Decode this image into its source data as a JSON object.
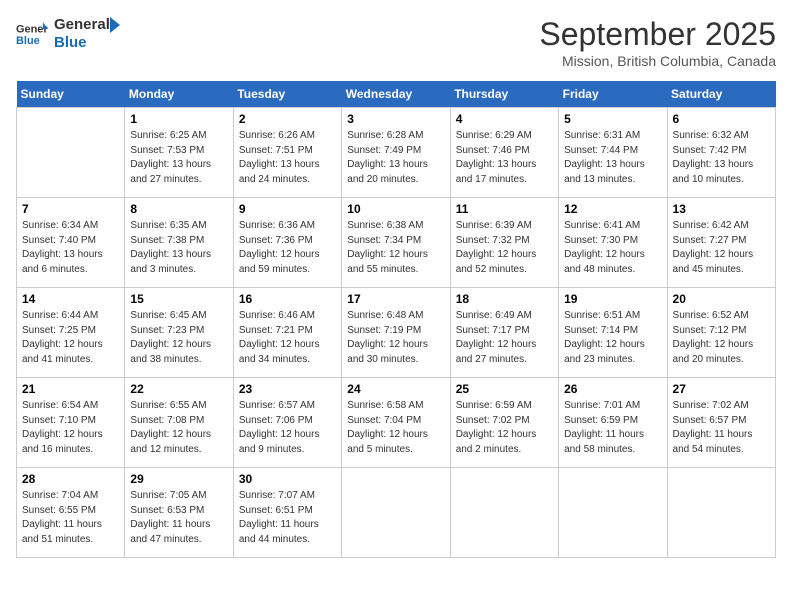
{
  "header": {
    "logo_line1": "General",
    "logo_line2": "Blue",
    "month": "September 2025",
    "location": "Mission, British Columbia, Canada"
  },
  "calendar": {
    "weekdays": [
      "Sunday",
      "Monday",
      "Tuesday",
      "Wednesday",
      "Thursday",
      "Friday",
      "Saturday"
    ],
    "weeks": [
      [
        {
          "day": "",
          "info": ""
        },
        {
          "day": "1",
          "info": "Sunrise: 6:25 AM\nSunset: 7:53 PM\nDaylight: 13 hours\nand 27 minutes."
        },
        {
          "day": "2",
          "info": "Sunrise: 6:26 AM\nSunset: 7:51 PM\nDaylight: 13 hours\nand 24 minutes."
        },
        {
          "day": "3",
          "info": "Sunrise: 6:28 AM\nSunset: 7:49 PM\nDaylight: 13 hours\nand 20 minutes."
        },
        {
          "day": "4",
          "info": "Sunrise: 6:29 AM\nSunset: 7:46 PM\nDaylight: 13 hours\nand 17 minutes."
        },
        {
          "day": "5",
          "info": "Sunrise: 6:31 AM\nSunset: 7:44 PM\nDaylight: 13 hours\nand 13 minutes."
        },
        {
          "day": "6",
          "info": "Sunrise: 6:32 AM\nSunset: 7:42 PM\nDaylight: 13 hours\nand 10 minutes."
        }
      ],
      [
        {
          "day": "7",
          "info": "Sunrise: 6:34 AM\nSunset: 7:40 PM\nDaylight: 13 hours\nand 6 minutes."
        },
        {
          "day": "8",
          "info": "Sunrise: 6:35 AM\nSunset: 7:38 PM\nDaylight: 13 hours\nand 3 minutes."
        },
        {
          "day": "9",
          "info": "Sunrise: 6:36 AM\nSunset: 7:36 PM\nDaylight: 12 hours\nand 59 minutes."
        },
        {
          "day": "10",
          "info": "Sunrise: 6:38 AM\nSunset: 7:34 PM\nDaylight: 12 hours\nand 55 minutes."
        },
        {
          "day": "11",
          "info": "Sunrise: 6:39 AM\nSunset: 7:32 PM\nDaylight: 12 hours\nand 52 minutes."
        },
        {
          "day": "12",
          "info": "Sunrise: 6:41 AM\nSunset: 7:30 PM\nDaylight: 12 hours\nand 48 minutes."
        },
        {
          "day": "13",
          "info": "Sunrise: 6:42 AM\nSunset: 7:27 PM\nDaylight: 12 hours\nand 45 minutes."
        }
      ],
      [
        {
          "day": "14",
          "info": "Sunrise: 6:44 AM\nSunset: 7:25 PM\nDaylight: 12 hours\nand 41 minutes."
        },
        {
          "day": "15",
          "info": "Sunrise: 6:45 AM\nSunset: 7:23 PM\nDaylight: 12 hours\nand 38 minutes."
        },
        {
          "day": "16",
          "info": "Sunrise: 6:46 AM\nSunset: 7:21 PM\nDaylight: 12 hours\nand 34 minutes."
        },
        {
          "day": "17",
          "info": "Sunrise: 6:48 AM\nSunset: 7:19 PM\nDaylight: 12 hours\nand 30 minutes."
        },
        {
          "day": "18",
          "info": "Sunrise: 6:49 AM\nSunset: 7:17 PM\nDaylight: 12 hours\nand 27 minutes."
        },
        {
          "day": "19",
          "info": "Sunrise: 6:51 AM\nSunset: 7:14 PM\nDaylight: 12 hours\nand 23 minutes."
        },
        {
          "day": "20",
          "info": "Sunrise: 6:52 AM\nSunset: 7:12 PM\nDaylight: 12 hours\nand 20 minutes."
        }
      ],
      [
        {
          "day": "21",
          "info": "Sunrise: 6:54 AM\nSunset: 7:10 PM\nDaylight: 12 hours\nand 16 minutes."
        },
        {
          "day": "22",
          "info": "Sunrise: 6:55 AM\nSunset: 7:08 PM\nDaylight: 12 hours\nand 12 minutes."
        },
        {
          "day": "23",
          "info": "Sunrise: 6:57 AM\nSunset: 7:06 PM\nDaylight: 12 hours\nand 9 minutes."
        },
        {
          "day": "24",
          "info": "Sunrise: 6:58 AM\nSunset: 7:04 PM\nDaylight: 12 hours\nand 5 minutes."
        },
        {
          "day": "25",
          "info": "Sunrise: 6:59 AM\nSunset: 7:02 PM\nDaylight: 12 hours\nand 2 minutes."
        },
        {
          "day": "26",
          "info": "Sunrise: 7:01 AM\nSunset: 6:59 PM\nDaylight: 11 hours\nand 58 minutes."
        },
        {
          "day": "27",
          "info": "Sunrise: 7:02 AM\nSunset: 6:57 PM\nDaylight: 11 hours\nand 54 minutes."
        }
      ],
      [
        {
          "day": "28",
          "info": "Sunrise: 7:04 AM\nSunset: 6:55 PM\nDaylight: 11 hours\nand 51 minutes."
        },
        {
          "day": "29",
          "info": "Sunrise: 7:05 AM\nSunset: 6:53 PM\nDaylight: 11 hours\nand 47 minutes."
        },
        {
          "day": "30",
          "info": "Sunrise: 7:07 AM\nSunset: 6:51 PM\nDaylight: 11 hours\nand 44 minutes."
        },
        {
          "day": "",
          "info": ""
        },
        {
          "day": "",
          "info": ""
        },
        {
          "day": "",
          "info": ""
        },
        {
          "day": "",
          "info": ""
        }
      ]
    ]
  }
}
